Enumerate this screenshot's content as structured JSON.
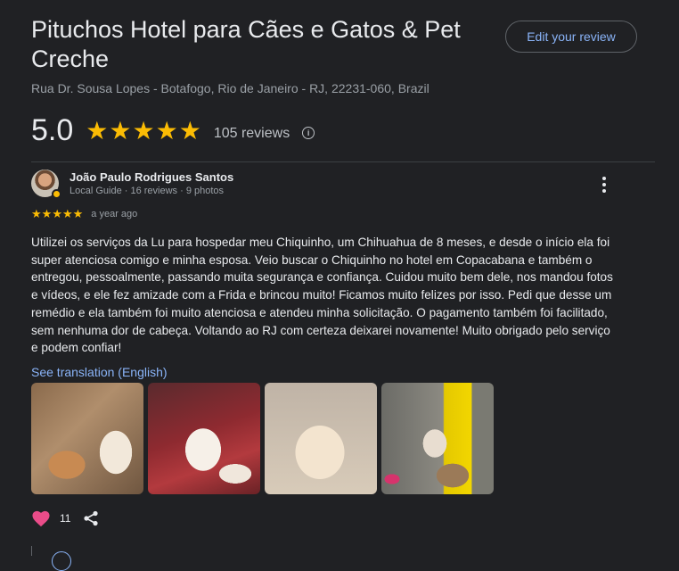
{
  "place": {
    "title": "Pituchos Hotel para Cães e Gatos & Pet Creche",
    "address": "Rua Dr. Sousa Lopes - Botafogo, Rio de Janeiro - RJ, 22231-060, Brazil"
  },
  "edit_review_label": "Edit your review",
  "summary": {
    "rating": "5.0",
    "stars": 5,
    "review_count": "105 reviews",
    "info_icon": "info-icon"
  },
  "review": {
    "author": "João Paulo Rodrigues Santos",
    "meta": "Local Guide · 16 reviews · 9 photos",
    "stars": 5,
    "time": "a year ago",
    "text": "Utilizei os serviços da Lu para hospedar meu Chiquinho, um Chihuahua de 8 meses, e desde o início ela foi super atenciosa comigo e minha esposa. Veio buscar o Chiquinho no hotel em Copacabana e também o entregou, pessoalmente, passando muita segurança e confiança. Cuidou muito bem dele, nos mandou fotos e vídeos, e ele fez amizade com a Frida e brincou muito! Ficamos muito felizes por isso. Pedi que desse um remédio e ela também foi muito atenciosa e atendeu minha solicitação. O pagamento também foi facilitado, sem nenhuma dor de cabeça. Voltando ao RJ com certeza deixarei novamente! Muito obrigado pelo serviço e podem confiar!",
    "translation_link": "See translation (English)",
    "photos": [
      "photo-1",
      "photo-2",
      "photo-3",
      "photo-4"
    ],
    "likes": "11"
  },
  "colors": {
    "background": "#202124",
    "star": "#fbbc04",
    "link": "#8ab4f8",
    "heart": "#ea4c89"
  }
}
